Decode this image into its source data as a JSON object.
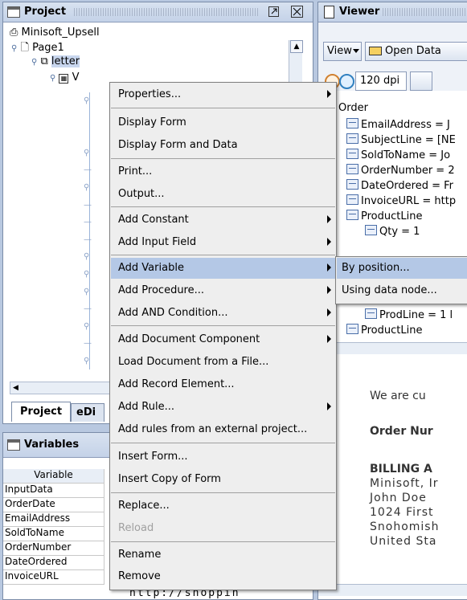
{
  "project_panel": {
    "title": "Project",
    "tree": {
      "root": "Minisoft_Upsell",
      "page": "Page1",
      "letter": "letter",
      "child_v": "V"
    },
    "tabs": [
      "Project",
      "eDi"
    ]
  },
  "variables_panel": {
    "title": "Variables",
    "column_header": "Variable",
    "rows": [
      "InputData",
      "OrderDate",
      "EmailAddress",
      "SoldToName",
      "OrderNumber",
      "DateOrdered",
      "InvoiceURL"
    ],
    "invoice_value": "http://shoppin"
  },
  "viewer_panel": {
    "title": "Viewer",
    "toolbar": {
      "view_label": "View",
      "open_label": "Open Data",
      "dpi": "120 dpi"
    },
    "data_tree": [
      "Order",
      "EmailAddress = J",
      "SubjectLine = [NE",
      "SoldToName = Jo",
      "OrderNumber = 2",
      "DateOrdered = Fr",
      "InvoiceURL = http",
      "ProductLine",
      "Qty = 1",
      "ProdLine = 1 l",
      "ProductLine"
    ],
    "document_lines": [
      "We are cu",
      "Order Nur",
      "BILLING A",
      "Minisoft, Ir",
      "John Doe",
      "1024 First",
      "Snohomish",
      "United Sta"
    ]
  },
  "context_menu": {
    "items": [
      {
        "label": "Properties...",
        "submenu": true
      },
      {
        "label": "Display Form"
      },
      {
        "label": "Display Form and Data"
      },
      {
        "label": "Print..."
      },
      {
        "label": "Output..."
      },
      {
        "label": "Add Constant",
        "submenu": true
      },
      {
        "label": "Add Input Field",
        "submenu": true
      },
      {
        "label": "Add Variable",
        "submenu": true
      },
      {
        "label": "Add Procedure...",
        "submenu": true
      },
      {
        "label": "Add AND Condition...",
        "submenu": true
      },
      {
        "label": "Add Document Component",
        "submenu": true
      },
      {
        "label": "Load Document from a File..."
      },
      {
        "label": "Add Record Element..."
      },
      {
        "label": "Add Rule...",
        "submenu": true
      },
      {
        "label": "Add rules from an external project..."
      },
      {
        "label": "Insert Form..."
      },
      {
        "label": "Insert Copy of Form"
      },
      {
        "label": "Replace..."
      },
      {
        "label": "Reload",
        "disabled": true
      },
      {
        "label": "Rename"
      },
      {
        "label": "Remove"
      }
    ]
  },
  "submenu": {
    "items": [
      {
        "label": "By position..."
      },
      {
        "label": "Using data node..."
      }
    ]
  },
  "colors": {
    "highlight": "#b4c8e6",
    "menu_bg": "#eeeeee",
    "tree_icon": "#4a6ea8"
  }
}
